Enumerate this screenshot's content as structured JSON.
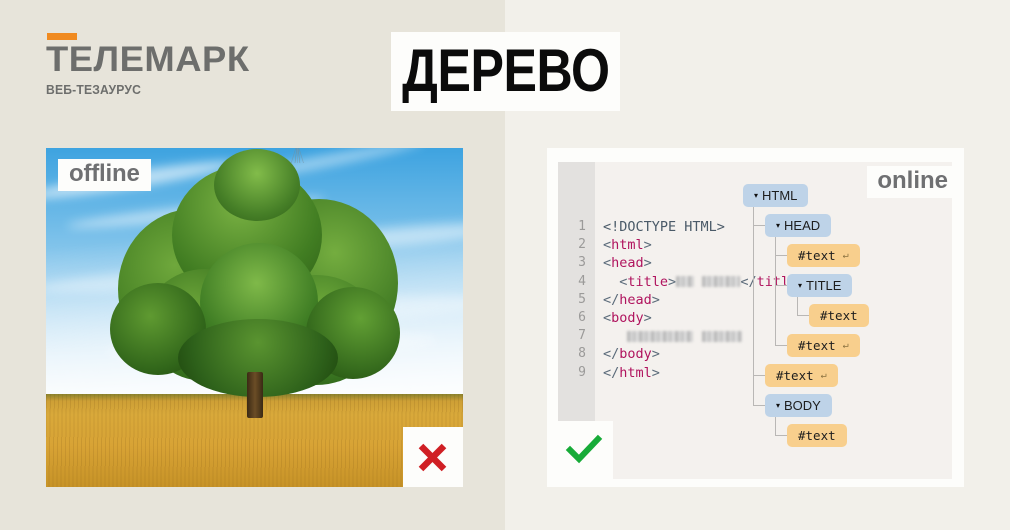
{
  "background": {
    "left_color": "#e7e4da",
    "right_color": "#f2f0ea"
  },
  "logo": {
    "bar_color": "#f08a20",
    "title": "ТЕЛЕМАРК",
    "subtitle": "ВЕБ-ТЕЗАУРУС",
    "text_color": "#6d6e6c"
  },
  "page_title": {
    "text": "ДЕРЕВО",
    "box_color": "#fdfdfb",
    "text_color": "#0b0b0b"
  },
  "offline_panel": {
    "badge_label": "offline",
    "badge_text_color": "#6f7072",
    "status_icon": "cross-icon",
    "status_color": "#d01f24",
    "photo_description": "tree-photo"
  },
  "online_panel": {
    "badge_label": "online",
    "badge_text_color": "#6f7072",
    "status_icon": "check-icon",
    "status_color": "#17ab38",
    "code_editor": {
      "gutter_color": "#e3e1df",
      "background": "#f4f1ee",
      "bracket_color": "#5b6b7a",
      "tag_color": "#b0145e",
      "lines": [
        {
          "number": "1",
          "parts": [
            {
              "t": "doct",
              "v": "<!DOCTYPE HTML>"
            }
          ]
        },
        {
          "number": "2",
          "parts": [
            {
              "t": "br",
              "v": "<"
            },
            {
              "t": "tag",
              "v": "html"
            },
            {
              "t": "br",
              "v": ">"
            }
          ]
        },
        {
          "number": "3",
          "parts": [
            {
              "t": "br",
              "v": "<"
            },
            {
              "t": "tag",
              "v": "head"
            },
            {
              "t": "br",
              "v": ">"
            }
          ]
        },
        {
          "number": "4",
          "parts": [
            {
              "t": "br",
              "v": "  <"
            },
            {
              "t": "tag",
              "v": "title"
            },
            {
              "t": "br",
              "v": ">"
            },
            {
              "t": "blur",
              "v": "18"
            },
            {
              "t": "plain",
              "v": " "
            },
            {
              "t": "blur",
              "v": "38"
            },
            {
              "t": "br",
              "v": "</"
            },
            {
              "t": "tag",
              "v": "title"
            },
            {
              "t": "br",
              "v": ">"
            }
          ]
        },
        {
          "number": "5",
          "parts": [
            {
              "t": "br",
              "v": "</"
            },
            {
              "t": "tag",
              "v": "head"
            },
            {
              "t": "br",
              "v": ">"
            }
          ]
        },
        {
          "number": "6",
          "parts": [
            {
              "t": "br",
              "v": "<"
            },
            {
              "t": "tag",
              "v": "body"
            },
            {
              "t": "br",
              "v": ">"
            }
          ]
        },
        {
          "number": "7",
          "parts": [
            {
              "t": "plain",
              "v": "   "
            },
            {
              "t": "blur",
              "v": "66"
            },
            {
              "t": "plain",
              "v": " "
            },
            {
              "t": "blur",
              "v": "40"
            }
          ]
        },
        {
          "number": "8",
          "parts": [
            {
              "t": "br",
              "v": "</"
            },
            {
              "t": "tag",
              "v": "body"
            },
            {
              "t": "br",
              "v": ">"
            }
          ]
        },
        {
          "number": "9",
          "parts": [
            {
              "t": "br",
              "v": "</"
            },
            {
              "t": "tag",
              "v": "html"
            },
            {
              "t": "br",
              "v": ">"
            }
          ]
        }
      ]
    },
    "dom_tree": {
      "element_color": "#bed3e8",
      "text_node_color": "#f8cf8d",
      "collapse_marker": "▾",
      "return_marker": "↵",
      "nodes": [
        {
          "label": "HTML",
          "kind": "element",
          "depth": 0,
          "collapsed": true,
          "newline": false
        },
        {
          "label": "HEAD",
          "kind": "element",
          "depth": 1,
          "collapsed": true,
          "newline": false
        },
        {
          "label": "#text",
          "kind": "text",
          "depth": 2,
          "collapsed": false,
          "newline": true
        },
        {
          "label": "TITLE",
          "kind": "element",
          "depth": 2,
          "collapsed": true,
          "newline": false
        },
        {
          "label": "#text",
          "kind": "text",
          "depth": 3,
          "collapsed": false,
          "newline": false
        },
        {
          "label": "#text",
          "kind": "text",
          "depth": 2,
          "collapsed": false,
          "newline": true
        },
        {
          "label": "#text",
          "kind": "text",
          "depth": 1,
          "collapsed": false,
          "newline": true
        },
        {
          "label": "BODY",
          "kind": "element",
          "depth": 1,
          "collapsed": true,
          "newline": false
        },
        {
          "label": "#text",
          "kind": "text",
          "depth": 2,
          "collapsed": false,
          "newline": false
        }
      ]
    }
  }
}
